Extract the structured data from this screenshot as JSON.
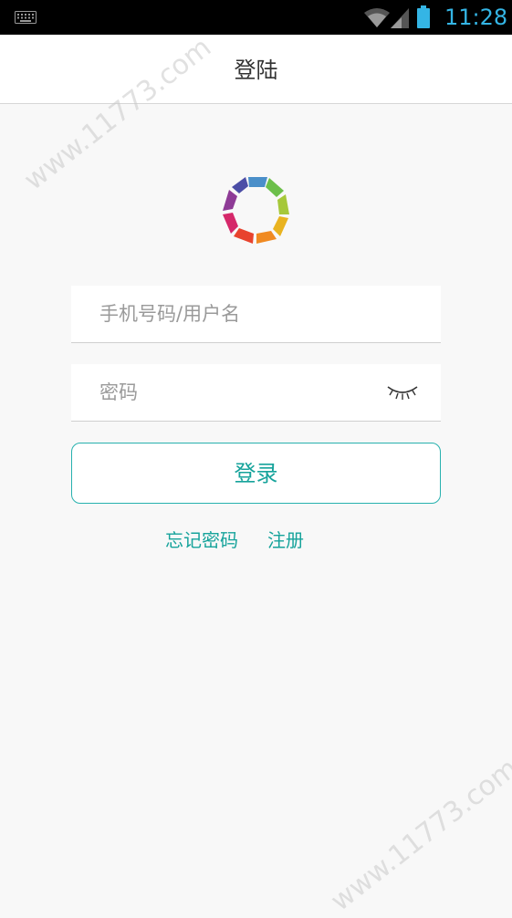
{
  "status_bar": {
    "time": "11:28",
    "icons": [
      "keyboard-icon",
      "wifi-icon",
      "signal-icon",
      "battery-icon"
    ]
  },
  "header": {
    "title": "登陆"
  },
  "watermark": {
    "text": "www.11773.com"
  },
  "form": {
    "username_placeholder": "手机号码/用户名",
    "password_placeholder": "密码",
    "toggle_icon": "eye-closed-icon",
    "login_label": "登录"
  },
  "links": {
    "forgot_password": "忘记密码",
    "register": "注册"
  },
  "colors": {
    "accent": "#16a39b",
    "status_time": "#34b5e5",
    "background": "#f8f8f8"
  }
}
